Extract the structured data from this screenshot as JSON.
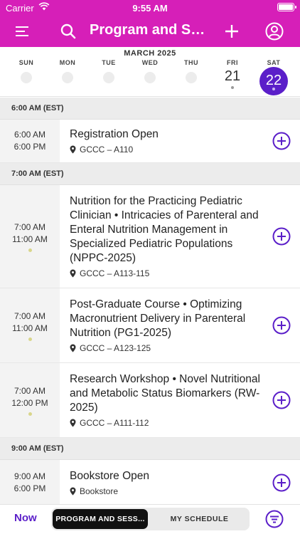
{
  "status_bar": {
    "carrier": "Carrier",
    "time": "9:55 AM"
  },
  "nav": {
    "title": "Program and Sessions"
  },
  "week": {
    "month": "MARCH 2025",
    "days": [
      {
        "dow": "SUN",
        "date": ""
      },
      {
        "dow": "MON",
        "date": ""
      },
      {
        "dow": "TUE",
        "date": ""
      },
      {
        "dow": "WED",
        "date": ""
      },
      {
        "dow": "THU",
        "date": ""
      },
      {
        "dow": "FRI",
        "date": "21"
      },
      {
        "dow": "SAT",
        "date": "22"
      }
    ],
    "selected_date": "22"
  },
  "schedule": [
    {
      "header": "6:00 AM (EST)",
      "events": [
        {
          "start": "6:00 AM",
          "end": "6:00 PM",
          "title": "Registration Open",
          "location": "GCCC – A110"
        }
      ]
    },
    {
      "header": "7:00 AM (EST)",
      "events": [
        {
          "start": "7:00 AM",
          "end": "11:00 AM",
          "title": "Nutrition for the Practicing Pediatric Clinician • Intricacies of Parenteral and Enteral Nutrition Management in Specialized Pediatric Populations (NPPC-2025)",
          "location": "GCCC – A113-115"
        },
        {
          "start": "7:00 AM",
          "end": "11:00 AM",
          "title": "Post-Graduate Course • Optimizing Macronutrient Delivery in Parenteral Nutrition (PG1-2025)",
          "location": "GCCC – A123-125"
        },
        {
          "start": "7:00 AM",
          "end": "12:00 PM",
          "title": "Research Workshop • Novel Nutritional and Metabolic Status Biomarkers (RW-2025)",
          "location": "GCCC – A111-112"
        }
      ]
    },
    {
      "header": "9:00 AM (EST)",
      "events": [
        {
          "start": "9:00 AM",
          "end": "6:00 PM",
          "title": "Bookstore Open",
          "location": "Bookstore"
        }
      ]
    }
  ],
  "bottom": {
    "now_label": "Now",
    "tab_active": "PROGRAM AND SESS...",
    "tab_other": "MY SCHEDULE"
  },
  "colors": {
    "brand": "#d61fb8",
    "accent": "#5b1fc9"
  },
  "icons": [
    "wifi-icon",
    "battery-icon",
    "menu-icon",
    "search-icon",
    "add-icon",
    "profile-icon",
    "location-pin-icon",
    "add-to-schedule-icon",
    "filter-icon"
  ]
}
